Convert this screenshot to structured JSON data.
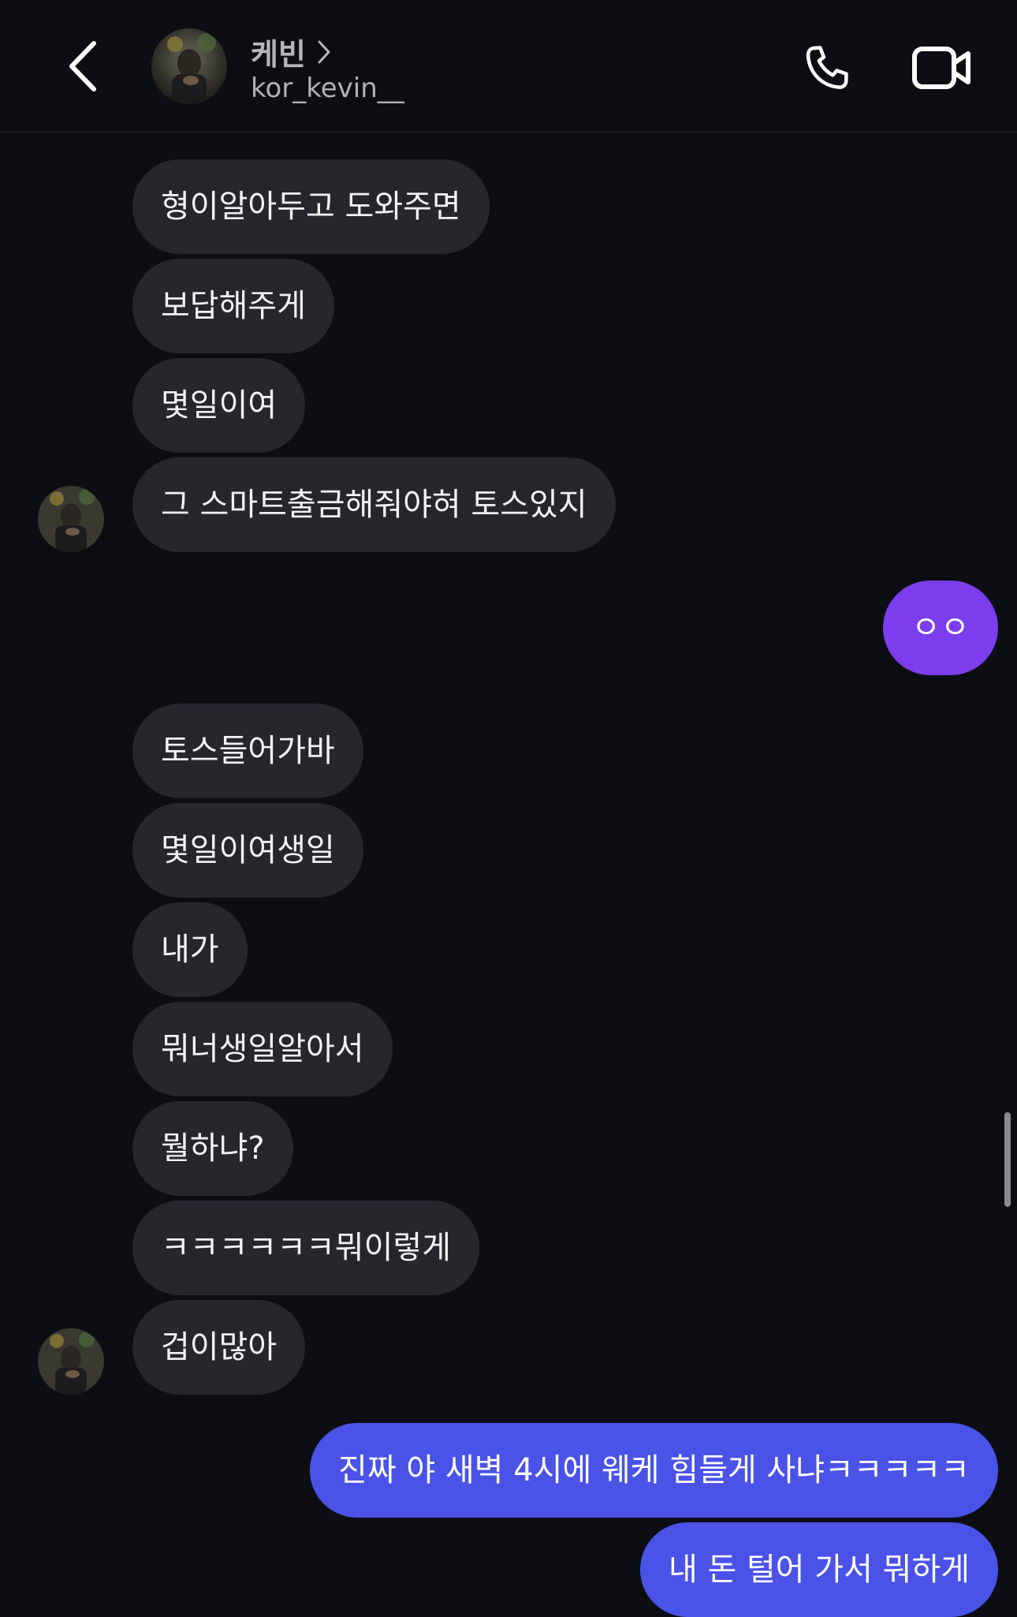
{
  "header": {
    "display_name": "케빈",
    "username": "kor_kevin__",
    "back_icon": "chevron-left-icon",
    "profile_chevron_icon": "chevron-right-icon",
    "call_icon": "phone-icon",
    "video_icon": "video-camera-icon"
  },
  "messages": [
    {
      "sender": "them",
      "text": "형이알아두고 도와주면"
    },
    {
      "sender": "them",
      "text": "보답해주게"
    },
    {
      "sender": "them",
      "text": "몇일이여"
    },
    {
      "sender": "them",
      "text": "그 스마트출금해줘야혀 토스있지"
    },
    {
      "sender": "me",
      "text": "ㅇㅇ"
    },
    {
      "sender": "them",
      "text": "토스들어가바"
    },
    {
      "sender": "them",
      "text": "몇일이여생일"
    },
    {
      "sender": "them",
      "text": "내가"
    },
    {
      "sender": "them",
      "text": "뭐너생일알아서"
    },
    {
      "sender": "them",
      "text": "뭘하냐?"
    },
    {
      "sender": "them",
      "text": "ㅋㅋㅋㅋㅋㅋ뭐이렇게"
    },
    {
      "sender": "them",
      "text": "겁이많아"
    },
    {
      "sender": "me",
      "text": "진짜 야 새벽 4시에 웨케 힘들게 사냐ㅋㅋㅋㅋㅋ"
    },
    {
      "sender": "me",
      "text": "내 돈 털어 가서 뭐하게"
    }
  ],
  "colors": {
    "background": "#0d0e13",
    "incoming_bubble": "#26272d",
    "outgoing_purple": "#7c3ded",
    "outgoing_blue": "#4a52e8"
  }
}
